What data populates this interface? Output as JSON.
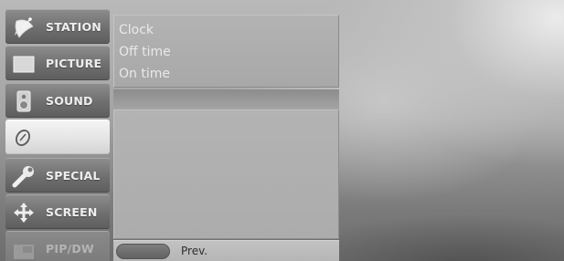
{
  "sidebar": {
    "items": [
      {
        "label": "STATION",
        "icon": "satellite-dish-icon"
      },
      {
        "label": "PICTURE",
        "icon": "picture-square-icon"
      },
      {
        "label": "SOUND",
        "icon": "speaker-icon"
      },
      {
        "label": "",
        "icon": "clock-timer-icon"
      },
      {
        "label": "SPECIAL",
        "icon": "wrench-icon"
      },
      {
        "label": "SCREEN",
        "icon": "move-arrows-icon"
      },
      {
        "label": "PIP/DW",
        "icon": "pip-window-icon"
      }
    ]
  },
  "submenu": {
    "items": [
      {
        "label": "Clock"
      },
      {
        "label": "Off time"
      },
      {
        "label": "On time"
      }
    ]
  },
  "footer": {
    "prev_label": "Prev."
  }
}
